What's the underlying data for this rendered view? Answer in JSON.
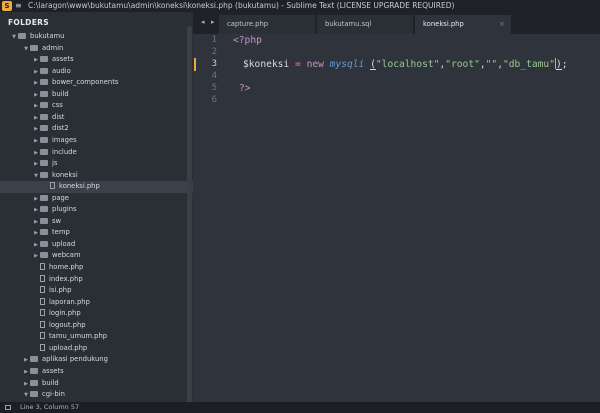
{
  "titlebar": {
    "app_icon": "S",
    "menu_icon": "≡",
    "title": "C:\\laragon\\www\\bukutamu\\admin\\koneksi\\koneksi.php (bukutamu) - Sublime Text (LICENSE UPGRADE REQUIRED)"
  },
  "sidebar": {
    "header": "FOLDERS",
    "items": [
      {
        "label": "bukutamu",
        "type": "folder",
        "expanded": true
      },
      {
        "label": "admin",
        "type": "folder",
        "expanded": true
      },
      {
        "label": "assets",
        "type": "folder",
        "expanded": false
      },
      {
        "label": "audio",
        "type": "folder",
        "expanded": false
      },
      {
        "label": "bower_components",
        "type": "folder",
        "expanded": false
      },
      {
        "label": "build",
        "type": "folder",
        "expanded": false
      },
      {
        "label": "css",
        "type": "folder",
        "expanded": false
      },
      {
        "label": "dist",
        "type": "folder",
        "expanded": false
      },
      {
        "label": "dist2",
        "type": "folder",
        "expanded": false
      },
      {
        "label": "images",
        "type": "folder",
        "expanded": false
      },
      {
        "label": "include",
        "type": "folder",
        "expanded": false
      },
      {
        "label": "js",
        "type": "folder",
        "expanded": false
      },
      {
        "label": "koneksi",
        "type": "folder",
        "expanded": true
      },
      {
        "label": "koneksi.php",
        "type": "file",
        "active": true
      },
      {
        "label": "page",
        "type": "folder",
        "expanded": false
      },
      {
        "label": "plugins",
        "type": "folder",
        "expanded": false
      },
      {
        "label": "sw",
        "type": "folder",
        "expanded": false
      },
      {
        "label": "temp",
        "type": "folder",
        "expanded": false
      },
      {
        "label": "upload",
        "type": "folder",
        "expanded": false
      },
      {
        "label": "webcam",
        "type": "folder",
        "expanded": false
      },
      {
        "label": "home.php",
        "type": "file"
      },
      {
        "label": "index.php",
        "type": "file"
      },
      {
        "label": "isi.php",
        "type": "file"
      },
      {
        "label": "laporan.php",
        "type": "file"
      },
      {
        "label": "login.php",
        "type": "file"
      },
      {
        "label": "logout.php",
        "type": "file"
      },
      {
        "label": "tamu_umum.php",
        "type": "file"
      },
      {
        "label": "upload.php",
        "type": "file"
      },
      {
        "label": "aplikasi pendukung",
        "type": "folder",
        "expanded": false
      },
      {
        "label": "assets",
        "type": "folder",
        "expanded": false
      },
      {
        "label": "build",
        "type": "folder",
        "expanded": false
      },
      {
        "label": "cgi-bin",
        "type": "folder",
        "expanded": true
      }
    ]
  },
  "tabs": {
    "prev": "◂",
    "next": "▸",
    "items": [
      {
        "label": "capture.php",
        "active": false
      },
      {
        "label": "bukutamu.sql",
        "active": false
      },
      {
        "label": "koneksi.php",
        "active": true
      }
    ],
    "close_glyph": "×"
  },
  "editor": {
    "line_numbers": [
      "1",
      "2",
      "3",
      "4",
      "5",
      "6"
    ],
    "current_line": "3",
    "code": {
      "line1": "<?php",
      "line3_var": "$koneksi",
      "line3_eq": "=",
      "line3_new": "new",
      "line3_class": "mysqli",
      "line3_open": "(",
      "line3_arg1": "\"localhost\"",
      "line3_comma1": ",",
      "line3_arg2": "\"root\"",
      "line3_comma2": ",",
      "line3_arg3": "\"\"",
      "line3_comma3": ",",
      "line3_arg4": "\"db_tamu\"",
      "line3_close": ")",
      "line3_semi": ";",
      "line5": "?>"
    }
  },
  "statusbar": {
    "text": "Line 3, Column 57"
  },
  "colors": {
    "accent": "#f0a93c",
    "string": "#99c794",
    "keyword": "#c594c5",
    "class": "#6699cc",
    "operator": "#f97b58"
  }
}
